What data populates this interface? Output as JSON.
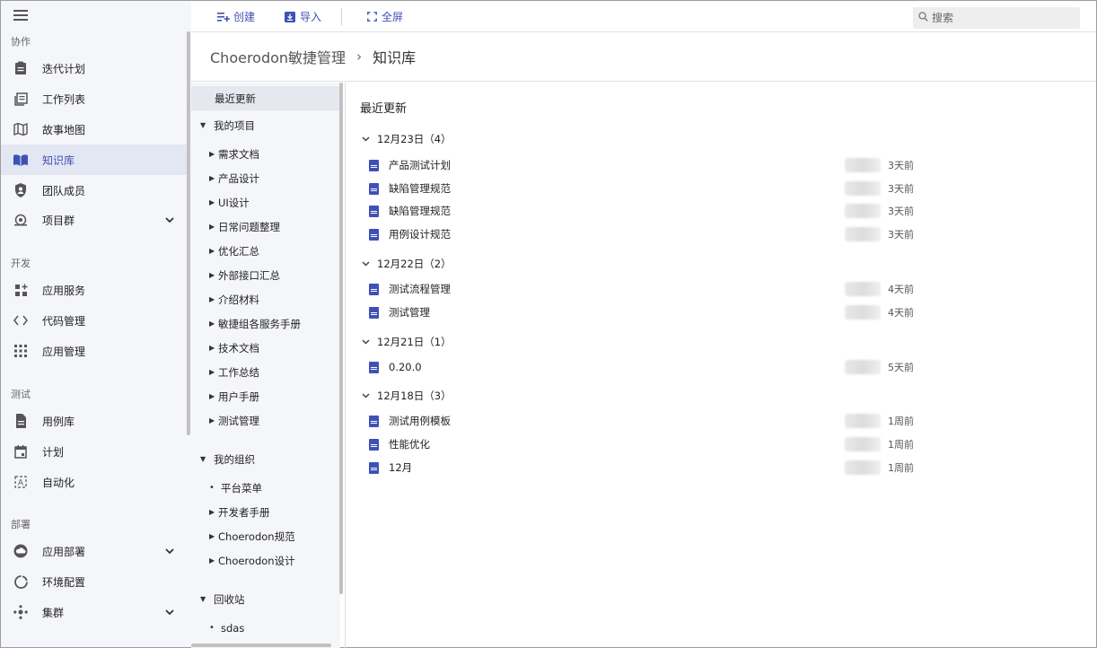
{
  "nav": {
    "sections": [
      {
        "title": "协作",
        "items": [
          {
            "label": "迭代计划",
            "icon": "clipboard-icon"
          },
          {
            "label": "工作列表",
            "icon": "list-icon"
          },
          {
            "label": "故事地图",
            "icon": "map-icon"
          },
          {
            "label": "知识库",
            "icon": "book-icon",
            "active": true
          },
          {
            "label": "团队成员",
            "icon": "shield-user-icon"
          },
          {
            "label": "项目群",
            "icon": "camera-icon",
            "expandable": true
          }
        ]
      },
      {
        "title": "开发",
        "items": [
          {
            "label": "应用服务",
            "icon": "grid-plus-icon"
          },
          {
            "label": "代码管理",
            "icon": "code-icon"
          },
          {
            "label": "应用管理",
            "icon": "apps-icon"
          }
        ]
      },
      {
        "title": "测试",
        "items": [
          {
            "label": "用例库",
            "icon": "document-icon"
          },
          {
            "label": "计划",
            "icon": "calendar-icon"
          },
          {
            "label": "自动化",
            "icon": "auto-icon"
          }
        ]
      },
      {
        "title": "部署",
        "items": [
          {
            "label": "应用部署",
            "icon": "cloud-icon",
            "expandable": true
          },
          {
            "label": "环境配置",
            "icon": "ring-icon"
          },
          {
            "label": "集群",
            "icon": "cluster-icon",
            "expandable": true
          }
        ]
      }
    ]
  },
  "toolbar": {
    "create_label": "创建",
    "import_label": "导入",
    "fullscreen_label": "全屏",
    "search_placeholder": "搜索"
  },
  "breadcrumb": {
    "root": "Choerodon敏捷管理",
    "separator": "›",
    "current": "知识库"
  },
  "tree": {
    "recent": "最近更新",
    "my_projects": {
      "label": "我的项目",
      "children": [
        "需求文档",
        "产品设计",
        "UI设计",
        "日常问题整理",
        "优化汇总",
        "外部接口汇总",
        "介绍材料",
        "敏捷组各服务手册",
        "技术文档",
        "工作总结",
        "用户手册",
        "测试管理"
      ]
    },
    "my_org": {
      "label": "我的组织",
      "children": [
        {
          "label": "平台菜单",
          "leaf": true
        },
        {
          "label": "开发者手册",
          "leaf": false
        },
        {
          "label": "Choerodon规范",
          "leaf": false
        },
        {
          "label": "Choerodon设计",
          "leaf": false
        }
      ]
    },
    "recycle": {
      "label": "回收站",
      "children": [
        "sdas"
      ]
    }
  },
  "main": {
    "title": "最近更新",
    "groups": [
      {
        "label": "12月23日（4）",
        "docs": [
          {
            "title": "产品测试计划",
            "time": "3天前"
          },
          {
            "title": "缺陷管理规范",
            "time": "3天前"
          },
          {
            "title": "缺陷管理规范",
            "time": "3天前"
          },
          {
            "title": "用例设计规范",
            "time": "3天前"
          }
        ]
      },
      {
        "label": "12月22日（2）",
        "docs": [
          {
            "title": "测试流程管理",
            "time": "4天前"
          },
          {
            "title": "测试管理",
            "time": "4天前"
          }
        ]
      },
      {
        "label": "12月21日（1）",
        "docs": [
          {
            "title": "0.20.0",
            "time": "5天前"
          }
        ]
      },
      {
        "label": "12月18日（3）",
        "docs": [
          {
            "title": "测试用例模板",
            "time": "1周前"
          },
          {
            "title": "性能优化",
            "time": "1周前"
          },
          {
            "title": "12月",
            "time": "1周前"
          }
        ]
      }
    ]
  },
  "colors": {
    "accent": "#3f51b5",
    "nav_bg": "#f5f6fa",
    "active_bg": "#e3e6f3"
  }
}
